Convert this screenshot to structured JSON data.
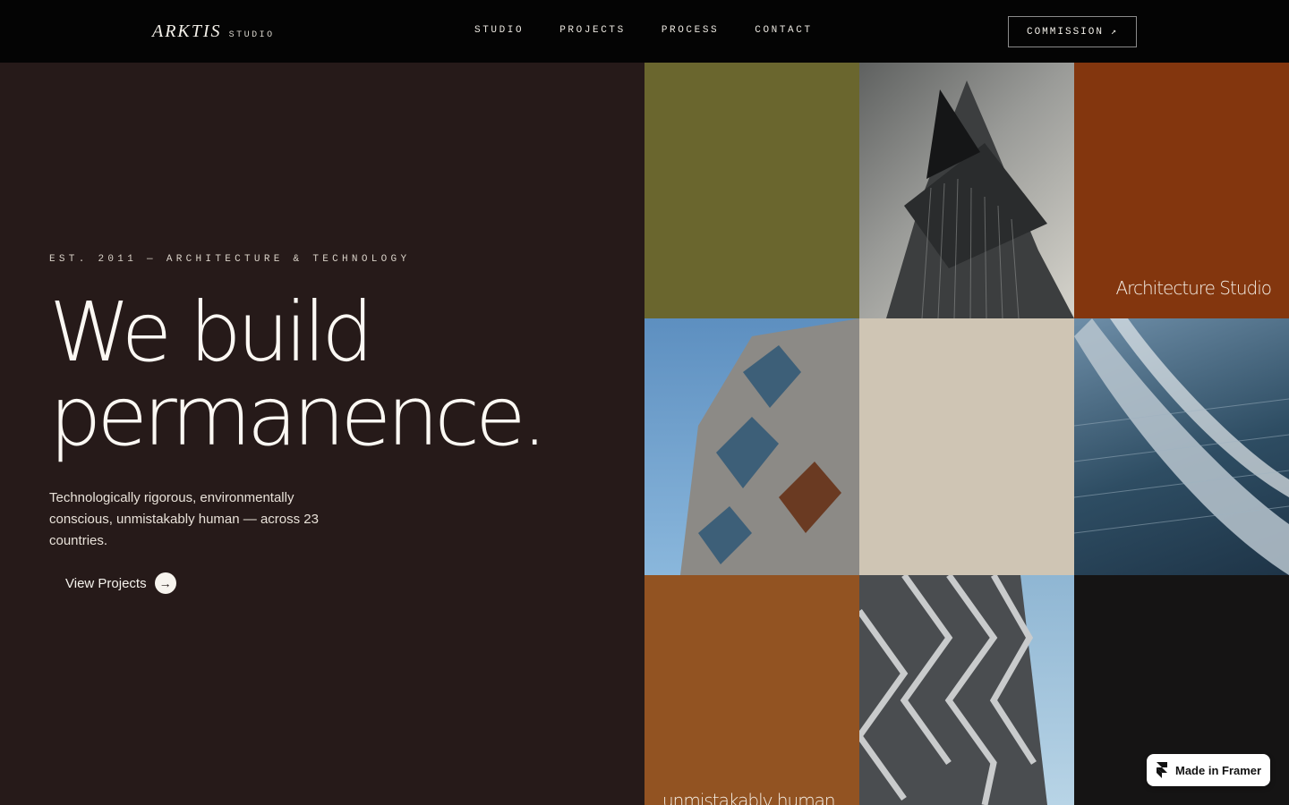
{
  "brand": {
    "name": "ARKTIS",
    "suffix": "STUDIO"
  },
  "nav": {
    "items": [
      {
        "label": "STUDIO"
      },
      {
        "label": "PROJECTS"
      },
      {
        "label": "PROCESS"
      },
      {
        "label": "CONTACT"
      }
    ],
    "cta_label": "COMMISSION",
    "cta_icon": "arrow-up-right-icon"
  },
  "hero": {
    "eyebrow": "EST. 2011 — ARCHITECTURE & TECHNOLOGY",
    "headline_line1": "We build",
    "headline_line2": "permanence.",
    "subtext": "Technologically rigorous, environmentally conscious, unmistakably human — across 23 countries.",
    "cta_label": "View Projects",
    "cta_icon": "arrow-right-icon"
  },
  "gallery": {
    "label_architecture": "Architecture Studio",
    "label_human": "unmistakably human",
    "colors": {
      "olive": "#6a662e",
      "rust": "#83360e",
      "sand": "#cfc5b4",
      "copper": "#925322",
      "dark": "#151414"
    }
  },
  "badge": {
    "label": "Made in Framer",
    "icon": "framer-logo-icon"
  },
  "colors": {
    "background_dark": "#261a19",
    "topbar": "#040404"
  }
}
